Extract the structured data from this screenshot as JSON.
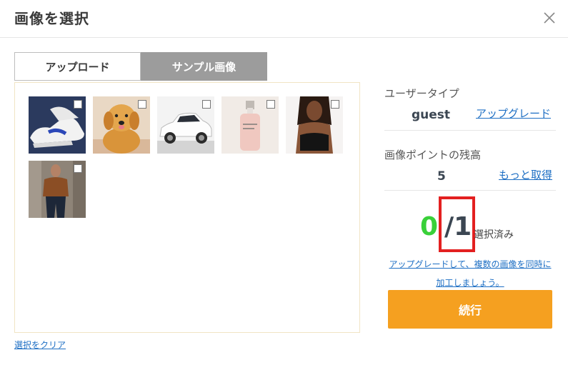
{
  "dialog": {
    "title": "画像を選択"
  },
  "tabs": [
    {
      "label": "アップロード"
    },
    {
      "label": "サンプル画像"
    }
  ],
  "images": [
    {
      "name": "sneakers"
    },
    {
      "name": "golden-retriever-puppy"
    },
    {
      "name": "white-car"
    },
    {
      "name": "cosmetic-bottle"
    },
    {
      "name": "woman-black-top"
    },
    {
      "name": "man-brown-shirt"
    }
  ],
  "clear_label": "選択をクリア",
  "sidebar": {
    "user_type_label": "ユーザータイプ",
    "user_type_value": "guest",
    "upgrade_link": "アップグレード",
    "points_label": "画像ポイントの残高",
    "points_value": "5",
    "get_more_link": "もっと取得",
    "selected_count": "0",
    "total_count": "/1",
    "selected_label": "選択済み",
    "upgrade_note_line1": "アップグレードして、複数の画像を同時に",
    "upgrade_note_line2": "加工しましょう。",
    "continue_button": "続行"
  },
  "colors": {
    "accent": "#f5a020",
    "selected_count": "#39d039",
    "link": "#1e6fc4",
    "active_tab": "#9c9c9c",
    "highlight_box": "#e32020"
  }
}
